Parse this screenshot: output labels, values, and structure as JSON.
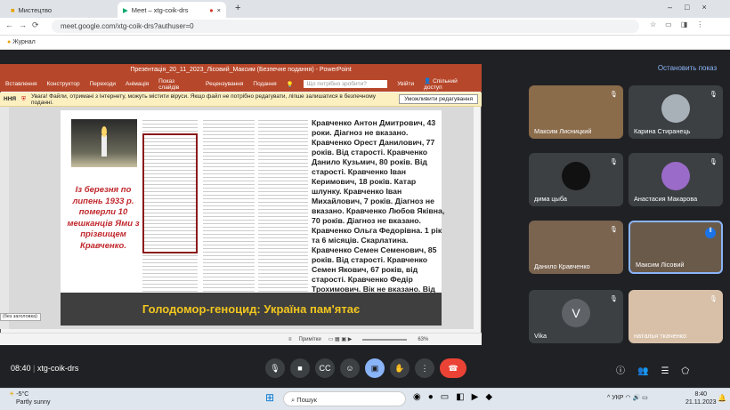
{
  "browser": {
    "tabs": [
      {
        "label": "Мистецтво"
      },
      {
        "label": "Meet – xtg-coik-drs"
      }
    ],
    "url": "meet.google.com/xtg-coik-drs?authuser=0",
    "bookmark": "Журнал"
  },
  "meet": {
    "stop_presenting": "Остановить показ",
    "meeting_time": "08:40",
    "meeting_code": "xtg-coik-drs",
    "participants": [
      {
        "name": "Максим Лисницкий"
      },
      {
        "name": "Карина Стиранець"
      },
      {
        "name": "дима цыба"
      },
      {
        "name": "Анастасия Макарова"
      },
      {
        "name": "Данило Кравченко"
      },
      {
        "name": "Максим Лісовий"
      },
      {
        "name": "Vika",
        "initial": "V"
      },
      {
        "name": "наталья ткаченко"
      }
    ]
  },
  "ppt": {
    "title": "Презентація_20_11_2023_Лісовий_Максим (Безпечне подання) - PowerPoint",
    "ribbon": [
      "Вставлення",
      "Конструктор",
      "Переходи",
      "Анімація",
      "Показ слайдів",
      "Рецензування",
      "Подання"
    ],
    "search_placeholder": "Що потрібно зробити?",
    "login": "Увійти",
    "share": "Спільний доступ",
    "warn_label": "ННЯ",
    "warning": "Увага! Файли, отримані з Інтернету, можуть містити віруси. Якщо файл не потрібно редагувати, ліпше залишатися в безпечному поданні.",
    "enable_edit": "Уможливити редагування",
    "slide_red_text": "Із березня по липень 1933 р. померли 10 мешканців Ями з прізвищем Кравченко.",
    "list_text": "Кравченко Антон Дмитрович, 43 роки. Діагноз не вказано. Кравченко Орест Данилович, 77 років. Від старості. Кравченко Данило Кузьмич, 80 років. Від старості. Кравченко Іван Керимович, 18 років. Катар шлунку. Кравченко Іван Михайлович, 7 років. Діагноз не вказано. Кравченко Любов Яківна, 70 років. Діагноз не вказано. Кравченко Ольга Федорівна. 1 рік та 6 місяців. Скарлатина. Кравченко Семен Семенович, 85 років. Від старості. Кравченко Семен Якович, 67 років, від старості. Кравченко Федір Трохимович. Вік не вказано. Від старості.",
    "banner": "Голодомор-геноцид: Україна пам'ятає",
    "thumb_label": "(без заголовка)",
    "notes": "Примітки",
    "zoom": "63%"
  },
  "taskbar": {
    "weather_temp": "-5°C",
    "weather_desc": "Partly sunny",
    "search": "Пошук",
    "lang": "УКР",
    "clock_time": "8:40",
    "clock_date": "21.11.2023"
  }
}
